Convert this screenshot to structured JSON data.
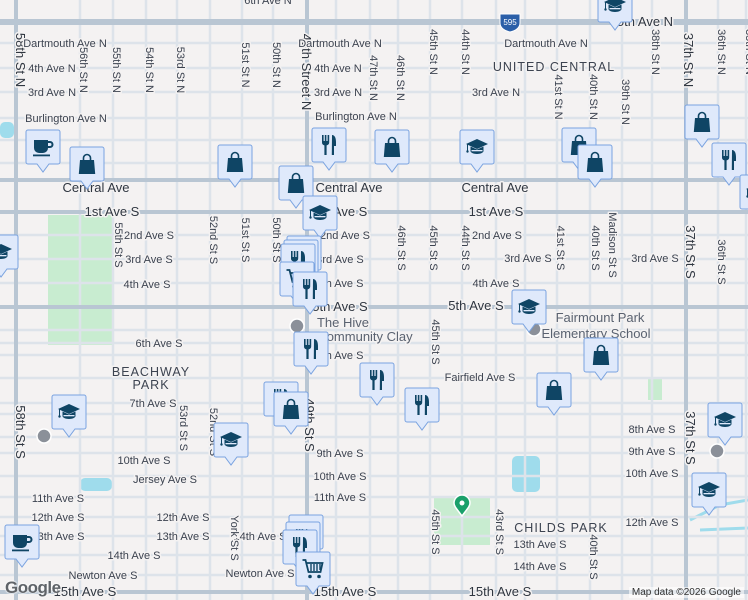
{
  "map": {
    "attribution": "Map data ©2026 Google",
    "logo": "Google",
    "highway_shield": "595",
    "colors": {
      "background": "#f4f2f2",
      "street": "#dde3ea",
      "major_street": "#b9c6d3",
      "park": "#c8ecd0",
      "water": "#9fdcec",
      "marker_fill": "#dfe9fb",
      "marker_border": "#7aa3e0",
      "marker_icon": "#0f4565",
      "poi_gray": "#8b9099",
      "park_pin": "#1aa06a"
    },
    "neighborhoods": [
      "UNITED CENTRAL",
      "BEACHWAY",
      "PARK",
      "CHILDS PARK"
    ],
    "pois": [
      "The Hive",
      "Community Clay",
      "Fairmount Park",
      "Elementary School"
    ],
    "major_streets": [
      "5th Ave N",
      "Central Ave",
      "Central Ave",
      "Central Ave",
      "1st Ave S",
      "1st Ave S",
      "1st Ave S",
      "5th Ave S",
      "5th Ave S",
      "15th Ave S",
      "15th Ave S",
      "15th Ave S",
      "49th Street N",
      "49th St S",
      "58th St N",
      "58th St S",
      "37th St N",
      "37th St S",
      "37th St S"
    ],
    "streets": [
      "6th Ave N",
      "Dartmouth Ave N",
      "Dartmouth Ave N",
      "Dartmouth Ave N",
      "4th Ave N",
      "4th Ave N",
      "3rd Ave N",
      "3rd Ave N",
      "3rd Ave N",
      "Burlington Ave N",
      "Burlington Ave N",
      "2nd Ave S",
      "2nd Ave S",
      "2nd Ave S",
      "3rd Ave S",
      "3rd Ave S",
      "3rd Ave S",
      "3rd Ave S",
      "4th Ave S",
      "4th Ave S",
      "4th Ave S",
      "6th Ave S",
      "7th Ave S",
      "Fairfield Ave S",
      "7th Ave S",
      "8th Ave S",
      "9th Ave S",
      "9th Ave S",
      "10th Ave S",
      "10th Ave S",
      "10th Ave S",
      "Jersey Ave S",
      "11th Ave S",
      "11th Ave S",
      "12th Ave S",
      "12th Ave S",
      "12th Ave S",
      "13th Ave S",
      "13th Ave S",
      "13th Ave S",
      "14th Ave S",
      "14th Ave S",
      "14th Ave S",
      "Newton Ave S",
      "Newton Ave S",
      "56th St N",
      "55th St N",
      "54th St N",
      "53rd St N",
      "51st St N",
      "50th St N",
      "47th St N",
      "46th St N",
      "45th St N",
      "44th St N",
      "41st St N",
      "40th St N",
      "39th St N",
      "38th St N",
      "36th St N",
      "35th St N",
      "55th St S",
      "52nd St S",
      "51st St S",
      "50th St S",
      "46th St S",
      "45th St S",
      "44th St S",
      "41st St S",
      "40th St S",
      "Madison St S",
      "36th St S",
      "45th St S",
      "53rd St S",
      "52nd St S",
      "York St S",
      "45th St S",
      "43rd St S",
      "40th St S"
    ],
    "markers": [
      "education",
      "coffee",
      "shopping",
      "shopping",
      "restaurant",
      "shopping",
      "education",
      "shopping",
      "shopping",
      "shopping",
      "restaurant",
      "shopping",
      "education",
      "education",
      "restaurant",
      "restaurant",
      "restaurant",
      "grocery",
      "restaurant",
      "education",
      "restaurant",
      "shopping",
      "restaurant",
      "shopping",
      "restaurant",
      "shopping",
      "restaurant",
      "education",
      "education",
      "education",
      "education",
      "coffee",
      "restaurant",
      "restaurant",
      "restaurant",
      "grocery",
      "education"
    ]
  }
}
